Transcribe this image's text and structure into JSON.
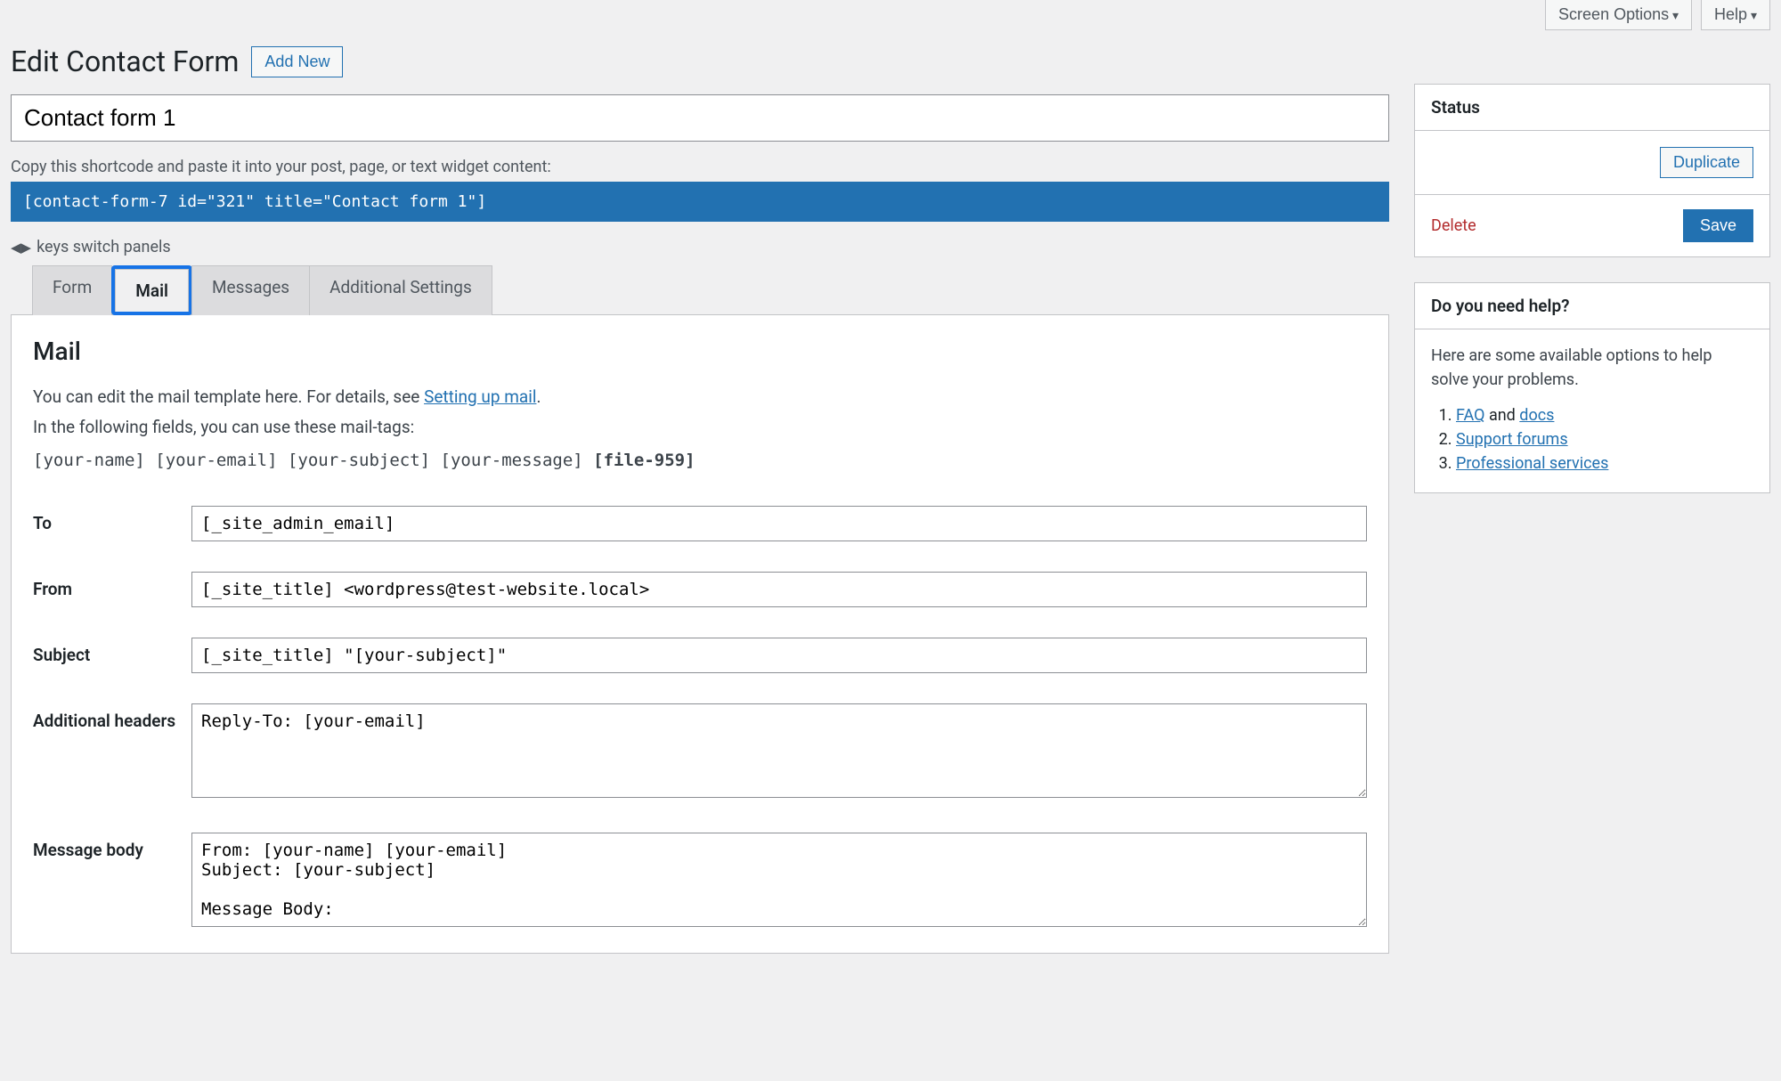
{
  "topBar": {
    "screenOptions": "Screen Options",
    "help": "Help"
  },
  "header": {
    "title": "Edit Contact Form",
    "addNew": "Add New"
  },
  "titleInput": "Contact form 1",
  "shortcode": {
    "label": "Copy this shortcode and paste it into your post, page, or text widget content:",
    "value": "[contact-form-7 id=\"321\" title=\"Contact form 1\"]"
  },
  "switchHint": "keys switch panels",
  "tabs": {
    "form": "Form",
    "mail": "Mail",
    "messages": "Messages",
    "additional": "Additional Settings"
  },
  "mailPanel": {
    "heading": "Mail",
    "intro1": "You can edit the mail template here. For details, see ",
    "introLink": "Setting up mail",
    "intro1End": ".",
    "intro2": "In the following fields, you can use these mail-tags:",
    "tags": "[your-name] [your-email] [your-subject] [your-message]",
    "tagsBold": "[file-959]",
    "fields": {
      "toLabel": "To",
      "toValue": "[_site_admin_email]",
      "fromLabel": "From",
      "fromValue": "[_site_title] <wordpress@test-website.local>",
      "subjectLabel": "Subject",
      "subjectValue": "[_site_title] \"[your-subject]\"",
      "addhLabel": "Additional headers",
      "addhValue": "Reply-To: [your-email]",
      "bodyLabel": "Message body",
      "bodyValue": "From: [your-name] [your-email]\nSubject: [your-subject]\n\nMessage Body:"
    }
  },
  "status": {
    "heading": "Status",
    "duplicate": "Duplicate",
    "delete": "Delete",
    "save": "Save"
  },
  "helpBox": {
    "heading": "Do you need help?",
    "intro": "Here are some available options to help solve your problems.",
    "faq": "FAQ",
    "and": " and ",
    "docs": "docs",
    "supportForums": "Support forums",
    "professional": "Professional services"
  }
}
